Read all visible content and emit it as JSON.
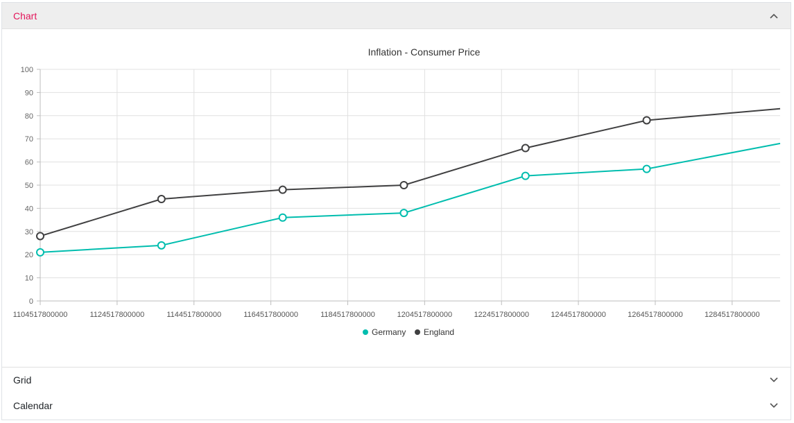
{
  "accordion": {
    "items": [
      {
        "label": "Chart",
        "expanded": true,
        "icon": "chevron-up-icon"
      },
      {
        "label": "Grid",
        "expanded": false,
        "icon": "chevron-down-icon"
      },
      {
        "label": "Calendar",
        "expanded": false,
        "icon": "chevron-down-icon"
      }
    ]
  },
  "colors": {
    "accent": "#e3165b",
    "germany": "#00bdae",
    "england": "#404041",
    "header_bg": "#eeeeee"
  },
  "chart_data": {
    "type": "line",
    "title": "Inflation - Consumer Price",
    "ylim": [
      0,
      100
    ],
    "yticks": [
      0,
      10,
      20,
      30,
      40,
      50,
      60,
      70,
      80,
      90,
      100
    ],
    "xlim": [
      1104517800000,
      1297000000000
    ],
    "xticks": [
      "1104517800000",
      "1124517800000",
      "1144517800000",
      "1164517800000",
      "1184517800000",
      "1204517800000",
      "1224517800000",
      "1244517800000",
      "1264517800000",
      "1284517800000"
    ],
    "x": [
      1104517800000,
      1136053800000,
      1167589800000,
      1199125800000,
      1230748200000,
      1262284200000,
      1297000000000
    ],
    "series": [
      {
        "name": "Germany",
        "values": [
          21,
          24,
          36,
          38,
          54,
          57,
          68
        ]
      },
      {
        "name": "England",
        "values": [
          28,
          44,
          48,
          50,
          66,
          78,
          83
        ]
      }
    ],
    "legend": "bottom",
    "grid": true
  }
}
